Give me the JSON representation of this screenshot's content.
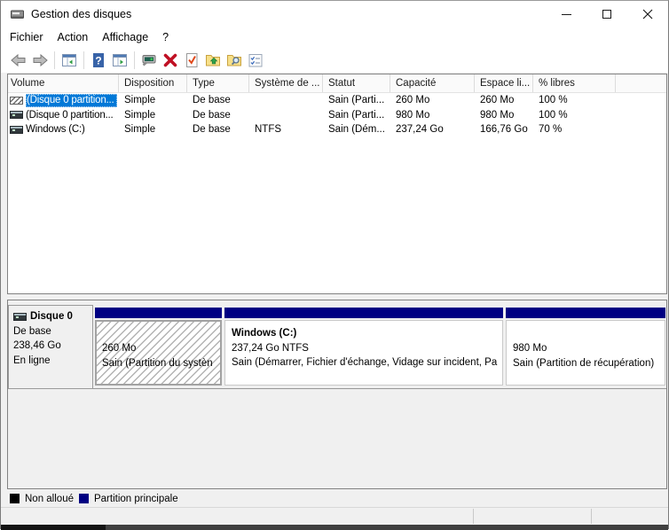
{
  "window": {
    "title": "Gestion des disques"
  },
  "menu": {
    "items": [
      "Fichier",
      "Action",
      "Affichage",
      "?"
    ]
  },
  "toolbar": {
    "icons": [
      "back",
      "forward",
      "toggle-console-tree",
      "help",
      "show-action-pane",
      "console-window",
      "delete",
      "check-document",
      "folder-up",
      "folder-search",
      "properties-list"
    ]
  },
  "table": {
    "columns": [
      "Volume",
      "Disposition",
      "Type",
      "Système de ...",
      "Statut",
      "Capacité",
      "Espace li...",
      "% libres"
    ],
    "rows": [
      {
        "volume": "(Disque 0 partition...",
        "disposition": "Simple",
        "type": "De base",
        "fs": "",
        "statut": "Sain (Parti...",
        "capacite": "260 Mo",
        "espace": "260 Mo",
        "libres": "100 %"
      },
      {
        "volume": "(Disque 0 partition...",
        "disposition": "Simple",
        "type": "De base",
        "fs": "",
        "statut": "Sain (Parti...",
        "capacite": "980 Mo",
        "espace": "980 Mo",
        "libres": "100 %"
      },
      {
        "volume": "Windows (C:)",
        "disposition": "Simple",
        "type": "De base",
        "fs": "NTFS",
        "statut": "Sain (Dém...",
        "capacite": "237,24 Go",
        "espace": "166,76 Go",
        "libres": "70 %"
      }
    ]
  },
  "disk": {
    "name": "Disque 0",
    "type": "De base",
    "size": "238,46 Go",
    "status": "En ligne",
    "partitions": [
      {
        "line1": "260 Mo",
        "line2": "Sain (Partition du systèn"
      },
      {
        "title": "Windows  (C:)",
        "line1": "237,24 Go NTFS",
        "line2": "Sain (Démarrer, Fichier d'échange, Vidage sur incident, Pa"
      },
      {
        "line1": "980 Mo",
        "line2": "Sain (Partition de récupération)"
      }
    ]
  },
  "legend": {
    "items": [
      {
        "label": "Non alloué",
        "color": "#000000"
      },
      {
        "label": "Partition principale",
        "color": "#000082"
      }
    ]
  },
  "colors": {
    "selection": "#0078d7",
    "partition_band": "#000082"
  }
}
